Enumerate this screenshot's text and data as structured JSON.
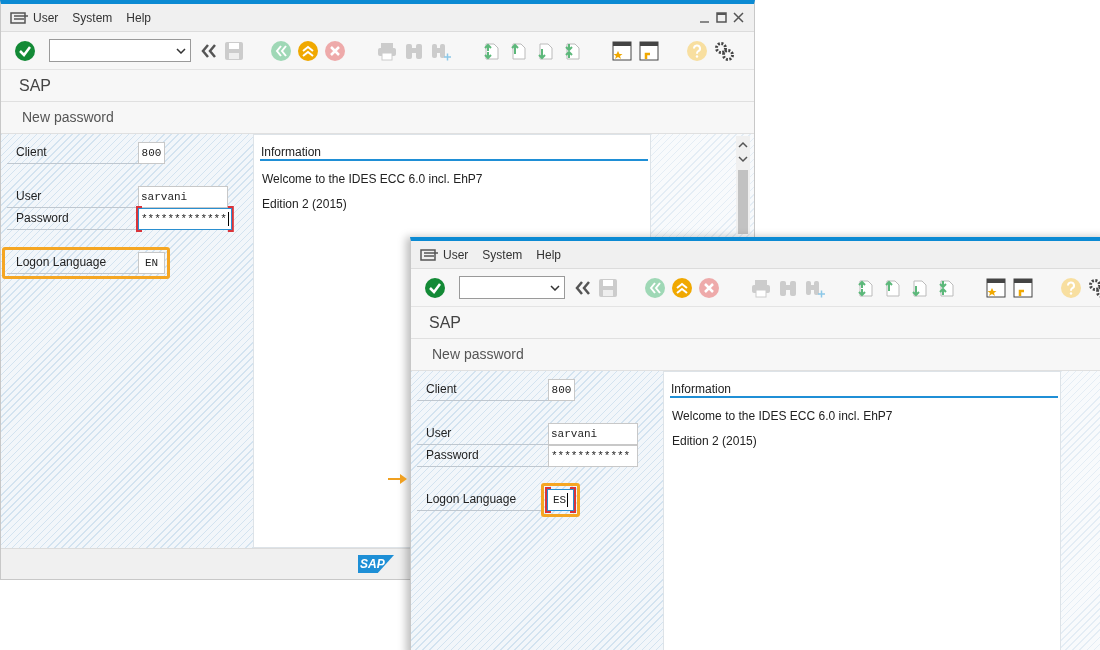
{
  "windows": [
    {
      "menu": [
        {
          "label": "User"
        },
        {
          "label": "System"
        },
        {
          "label": "Help"
        }
      ],
      "window_controls": true,
      "title": "SAP",
      "subtitle": "New password",
      "scrollbar": true,
      "field_groups": [
        [
          {
            "label": "Client",
            "value": "800",
            "kind": "short",
            "focused": false,
            "row_highlighted": false,
            "field_highlighted": false
          }
        ],
        [
          {
            "label": "User",
            "value": "sarvani",
            "kind": "long",
            "focused": false,
            "row_highlighted": false,
            "field_highlighted": false
          },
          {
            "label": "Password",
            "value": "*************",
            "kind": "long",
            "focused": true,
            "row_highlighted": false,
            "field_highlighted": false
          }
        ],
        [
          {
            "label": "Logon Language",
            "value": "EN",
            "kind": "short",
            "focused": false,
            "row_highlighted": true,
            "field_highlighted": false
          }
        ]
      ],
      "info": {
        "heading": "Information",
        "lines": [
          "Welcome to the IDES ECC 6.0 incl. EhP7",
          "Edition 2 (2015)"
        ]
      },
      "logo": "SAP"
    },
    {
      "menu": [
        {
          "label": "User"
        },
        {
          "label": "System"
        },
        {
          "label": "Help"
        }
      ],
      "window_controls": false,
      "title": "SAP",
      "subtitle": "New password",
      "scrollbar": false,
      "field_groups": [
        [
          {
            "label": "Client",
            "value": "800",
            "kind": "short",
            "focused": false,
            "row_highlighted": false,
            "field_highlighted": false
          }
        ],
        [
          {
            "label": "User",
            "value": "sarvani",
            "kind": "long",
            "focused": false,
            "row_highlighted": false,
            "field_highlighted": false
          },
          {
            "label": "Password",
            "value": "************",
            "kind": "long",
            "focused": false,
            "row_highlighted": false,
            "field_highlighted": false
          }
        ],
        [
          {
            "label": "Logon Language",
            "value": "ES",
            "kind": "short",
            "focused": true,
            "row_highlighted": false,
            "field_highlighted": true
          }
        ]
      ],
      "info": {
        "heading": "Information",
        "lines": [
          "Welcome to the IDES ECC 6.0 incl. EhP7",
          "Edition 2 (2015)"
        ]
      }
    }
  ]
}
